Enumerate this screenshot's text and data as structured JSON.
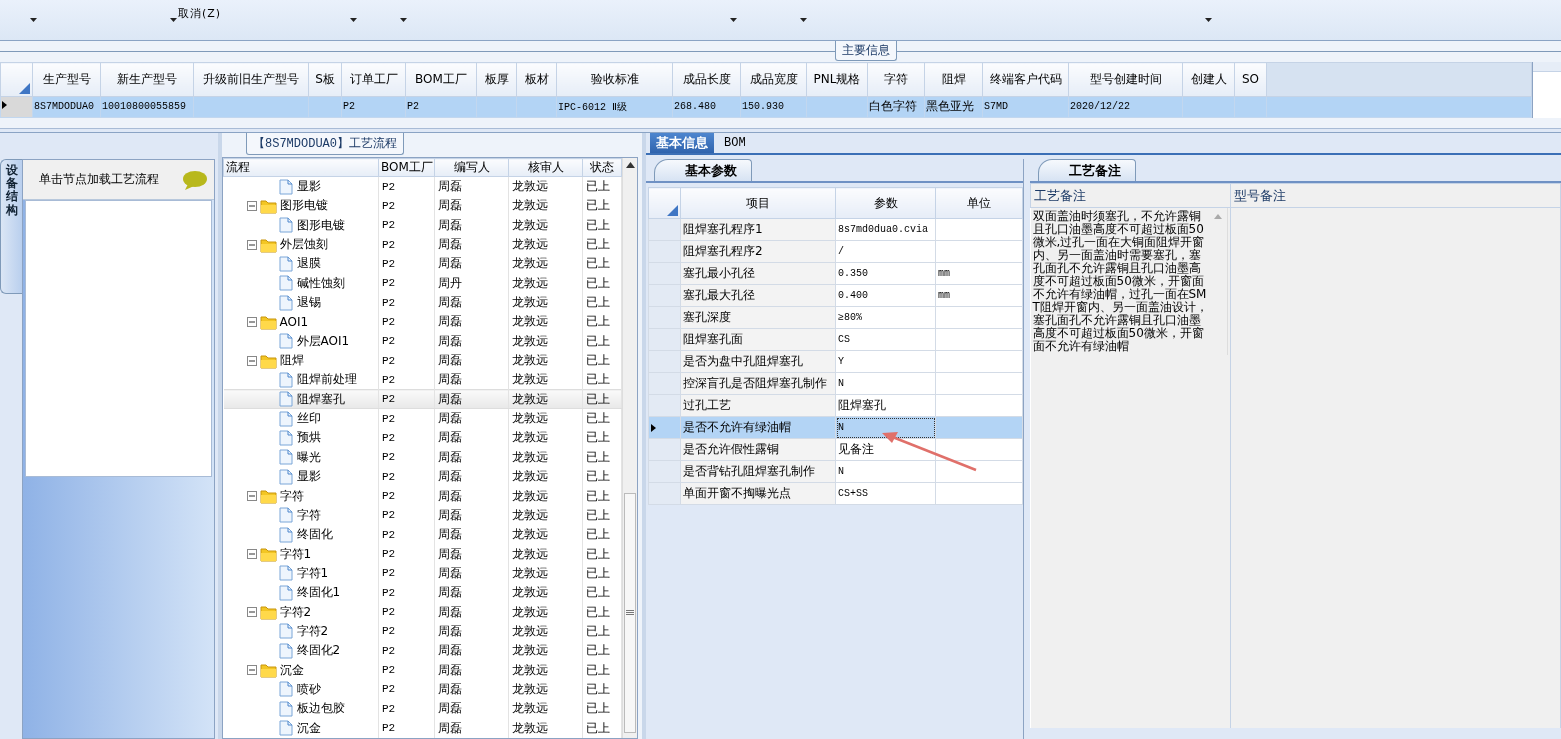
{
  "toolbar": {
    "menu_item": "取消(Z)"
  },
  "main_section": {
    "legend": "主要信息"
  },
  "main_grid": {
    "columns": [
      "生产型号",
      "新生产型号",
      "升级前旧生产型号",
      "S板",
      "订单工厂",
      "BOM工厂",
      "板厚",
      "板材",
      "验收标准",
      "成品长度",
      "成品宽度",
      "PNL规格",
      "字符",
      "阻焊",
      "终端客户代码",
      "型号创建时间",
      "创建人",
      "SO"
    ],
    "rows": [
      {
        "selected": true,
        "cells": [
          "8S7MDODUA0",
          "10010800055859",
          null,
          null,
          "P2",
          "P2",
          null,
          null,
          "IPC-6012 Ⅱ级",
          "268.480",
          "150.930",
          null,
          "白色字符",
          "黑色亚光",
          "S7MD",
          "2020/12/22",
          null,
          null
        ]
      }
    ]
  },
  "left_panel": {
    "vertical_tab": "设备结构",
    "hint": "单击节点加载工艺流程"
  },
  "process_section": {
    "legend": "【8S7MDODUA0】工艺流程"
  },
  "process_tree": {
    "columns": [
      "流程",
      "BOM工厂",
      "编写人",
      "核审人",
      "状态"
    ],
    "nodes": [
      {
        "kind": "file",
        "label": "显影",
        "bom": "P2",
        "writer": "周磊",
        "reviewer": "龙敦远",
        "status": "已上",
        "selected": false
      },
      {
        "kind": "folder",
        "label": "图形电镀",
        "bom": "P2",
        "writer": "周磊",
        "reviewer": "龙敦远",
        "status": "已上",
        "selected": false,
        "expanded": true,
        "children": [
          {
            "kind": "file",
            "label": "图形电镀",
            "bom": "P2",
            "writer": "周磊",
            "reviewer": "龙敦远",
            "status": "已上",
            "selected": false
          }
        ]
      },
      {
        "kind": "folder",
        "label": "外层蚀刻",
        "bom": "P2",
        "writer": "周磊",
        "reviewer": "龙敦远",
        "status": "已上",
        "selected": false,
        "expanded": true,
        "children": [
          {
            "kind": "file",
            "label": "退膜",
            "bom": "P2",
            "writer": "周磊",
            "reviewer": "龙敦远",
            "status": "已上",
            "selected": false
          },
          {
            "kind": "file",
            "label": "碱性蚀刻",
            "bom": "P2",
            "writer": "周丹",
            "reviewer": "龙敦远",
            "status": "已上",
            "selected": false
          },
          {
            "kind": "file",
            "label": "退锡",
            "bom": "P2",
            "writer": "周磊",
            "reviewer": "龙敦远",
            "status": "已上",
            "selected": false
          }
        ]
      },
      {
        "kind": "folder",
        "label": "AOI1",
        "bom": "P2",
        "writer": "周磊",
        "reviewer": "龙敦远",
        "status": "已上",
        "selected": false,
        "expanded": true,
        "children": [
          {
            "kind": "file",
            "label": "外层AOI1",
            "bom": "P2",
            "writer": "周磊",
            "reviewer": "龙敦远",
            "status": "已上",
            "selected": false
          }
        ]
      },
      {
        "kind": "folder",
        "label": "阻焊",
        "bom": "P2",
        "writer": "周磊",
        "reviewer": "龙敦远",
        "status": "已上",
        "selected": false,
        "expanded": true,
        "children": [
          {
            "kind": "file",
            "label": "阻焊前处理",
            "bom": "P2",
            "writer": "周磊",
            "reviewer": "龙敦远",
            "status": "已上",
            "selected": false
          },
          {
            "kind": "file",
            "label": "阻焊塞孔",
            "bom": "P2",
            "writer": "周磊",
            "reviewer": "龙敦远",
            "status": "已上",
            "selected": true
          },
          {
            "kind": "file",
            "label": "丝印",
            "bom": "P2",
            "writer": "周磊",
            "reviewer": "龙敦远",
            "status": "已上",
            "selected": false
          },
          {
            "kind": "file",
            "label": "预烘",
            "bom": "P2",
            "writer": "周磊",
            "reviewer": "龙敦远",
            "status": "已上",
            "selected": false
          },
          {
            "kind": "file",
            "label": "曝光",
            "bom": "P2",
            "writer": "周磊",
            "reviewer": "龙敦远",
            "status": "已上",
            "selected": false
          },
          {
            "kind": "file",
            "label": "显影",
            "bom": "P2",
            "writer": "周磊",
            "reviewer": "龙敦远",
            "status": "已上",
            "selected": false
          }
        ]
      },
      {
        "kind": "folder",
        "label": "字符",
        "bom": "P2",
        "writer": "周磊",
        "reviewer": "龙敦远",
        "status": "已上",
        "selected": false,
        "expanded": true,
        "children": [
          {
            "kind": "file",
            "label": "字符",
            "bom": "P2",
            "writer": "周磊",
            "reviewer": "龙敦远",
            "status": "已上",
            "selected": false
          },
          {
            "kind": "file",
            "label": "终固化",
            "bom": "P2",
            "writer": "周磊",
            "reviewer": "龙敦远",
            "status": "已上",
            "selected": false
          }
        ]
      },
      {
        "kind": "folder",
        "label": "字符1",
        "bom": "P2",
        "writer": "周磊",
        "reviewer": "龙敦远",
        "status": "已上",
        "selected": false,
        "expanded": true,
        "children": [
          {
            "kind": "file",
            "label": "字符1",
            "bom": "P2",
            "writer": "周磊",
            "reviewer": "龙敦远",
            "status": "已上",
            "selected": false
          },
          {
            "kind": "file",
            "label": "终固化1",
            "bom": "P2",
            "writer": "周磊",
            "reviewer": "龙敦远",
            "status": "已上",
            "selected": false
          }
        ]
      },
      {
        "kind": "folder",
        "label": "字符2",
        "bom": "P2",
        "writer": "周磊",
        "reviewer": "龙敦远",
        "status": "已上",
        "selected": false,
        "expanded": true,
        "children": [
          {
            "kind": "file",
            "label": "字符2",
            "bom": "P2",
            "writer": "周磊",
            "reviewer": "龙敦远",
            "status": "已上",
            "selected": false
          },
          {
            "kind": "file",
            "label": "终固化2",
            "bom": "P2",
            "writer": "周磊",
            "reviewer": "龙敦远",
            "status": "已上",
            "selected": false
          }
        ]
      },
      {
        "kind": "folder",
        "label": "沉金",
        "bom": "P2",
        "writer": "周磊",
        "reviewer": "龙敦远",
        "status": "已上",
        "selected": false,
        "expanded": true,
        "children": [
          {
            "kind": "file",
            "label": "喷砂",
            "bom": "P2",
            "writer": "周磊",
            "reviewer": "龙敦远",
            "status": "已上",
            "selected": false
          },
          {
            "kind": "file",
            "label": "板边包胶",
            "bom": "P2",
            "writer": "周磊",
            "reviewer": "龙敦远",
            "status": "已上",
            "selected": false
          },
          {
            "kind": "file",
            "label": "沉金",
            "bom": "P2",
            "writer": "周磊",
            "reviewer": "龙敦远",
            "status": "已上",
            "selected": false
          }
        ]
      }
    ]
  },
  "detail_tabs": [
    {
      "label": "基本信息",
      "selected": true
    },
    {
      "label": "BOM",
      "selected": false
    }
  ],
  "params_panel": {
    "tab": "基本参数",
    "columns": [
      "项目",
      "参数",
      "单位"
    ],
    "rows": [
      {
        "item": "阻焊塞孔程序1",
        "value": "8s7md0dua0.cvia",
        "selected": false
      },
      {
        "item": "阻焊塞孔程序2",
        "value": "/",
        "selected": false
      },
      {
        "item": "塞孔最小孔径",
        "value": "0.350",
        "unit": "mm",
        "selected": false
      },
      {
        "item": "塞孔最大孔径",
        "value": "0.400",
        "unit": "mm",
        "selected": false
      },
      {
        "item": "塞孔深度",
        "value": "≥80%",
        "selected": false
      },
      {
        "item": "阻焊塞孔面",
        "value": "CS",
        "selected": false
      },
      {
        "item": "是否为盘中孔阻焊塞孔",
        "value": "Y",
        "selected": false
      },
      {
        "item": "控深盲孔是否阻焊塞孔制作",
        "value": "N",
        "selected": false
      },
      {
        "item": "过孔工艺",
        "value": "阻焊塞孔",
        "selected": false
      },
      {
        "item": "是否不允许有绿油帽",
        "value": "N",
        "selected": true
      },
      {
        "item": "是否允许假性露铜",
        "value": "见备注",
        "selected": false
      },
      {
        "item": "是否背钻孔阻焊塞孔制作",
        "value": "N",
        "selected": false
      },
      {
        "item": "单面开窗不掏曝光点",
        "value": "CS+SS",
        "selected": false
      }
    ]
  },
  "notes_panel": {
    "tab": "工艺备注",
    "columns": [
      "工艺备注",
      "型号备注"
    ],
    "text": "双面盖油时须塞孔，不允许露铜且孔口油墨高度不可超过板面50微米,过孔一面在大铜面阻焊开窗内、另一面盖油时需要塞孔，塞孔面孔不允许露铜且孔口油墨高度不可超过板面50微米，开窗面不允许有绿油帽，过孔一面在SMT阻焊开窗内、另一面盖油设计，塞孔面孔不允许露铜且孔口油墨高度不可超过板面50微米，开窗面不允许有绿油帽"
  }
}
